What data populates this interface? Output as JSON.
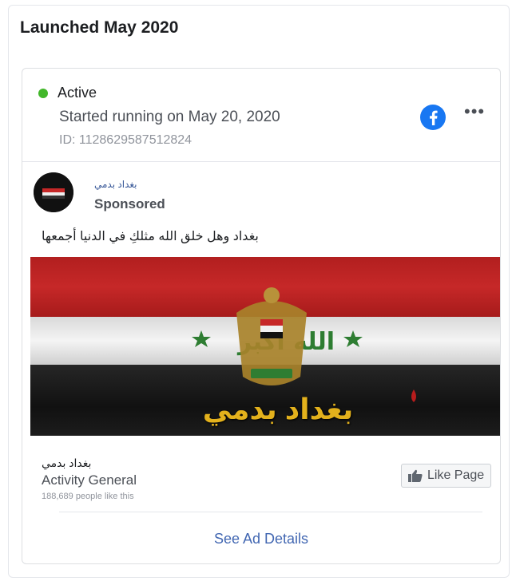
{
  "section": {
    "title": "Launched May 2020"
  },
  "status": {
    "label": "Active",
    "started": "Started running on May 20, 2020",
    "id": "ID: 1128629587512824",
    "dot_color": "#42b72a"
  },
  "icons": {
    "platform": "facebook-icon",
    "more": "more-options-icon"
  },
  "post": {
    "page_name": "بغداد بدمي",
    "sponsored": "Sponsored",
    "caption": "بغداد وهل خلق الله مثلكِ في الدنيا أجمعها",
    "image_text": "بغداد بدمي"
  },
  "footer": {
    "page_name": "بغداد بدمي",
    "category": "Activity General",
    "likes": "188,689 people like this",
    "like_button": "Like Page"
  },
  "actions": {
    "see_details": "See Ad Details"
  },
  "colors": {
    "link": "#4267b2",
    "flag_red": "#c62828",
    "flag_black": "#111111",
    "text_gold": "#e3b11c"
  }
}
